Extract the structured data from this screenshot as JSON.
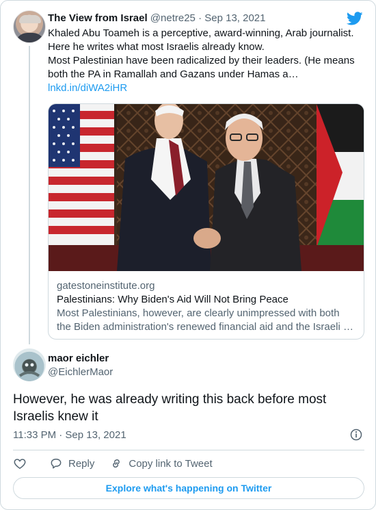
{
  "quoted": {
    "author_name": "The View from Israel",
    "handle": "@netre25",
    "separator": "·",
    "date": "Sep 13, 2021",
    "text_lines": [
      "Khaled Abu Toameh is a perceptive, award-winning, Arab journalist.",
      "Here he writes what most Israelis already know.",
      "Most Palestinian have been radicalized by their leaders. (He means",
      "both the PA in Ramallah and Gazans under Hamas a…"
    ],
    "link": "lnkd.in/diWA2iHR",
    "card": {
      "domain": "gatestoneinstitute.org",
      "title": "Palestinians: Why Biden's Aid Will Not Bring Peace",
      "description_lines": [
        "Most Palestinians, however, are clearly unimpressed with both",
        "the Biden administration's renewed financial aid and the Israeli …"
      ]
    }
  },
  "tweet": {
    "author_name": "maor eichler",
    "handle": "@EichlerMaor",
    "text": "However, he was already writing this back before most Israelis knew it",
    "timestamp": "11:33 PM · Sep 13, 2021"
  },
  "actions": {
    "reply_label": "Reply",
    "copy_label": "Copy link to Tweet"
  },
  "explore_label": "Explore what's happening on Twitter",
  "icons": {
    "brand": "twitter-bird-icon",
    "like": "heart-icon",
    "reply": "speech-bubble-icon",
    "copy": "link-icon",
    "info": "info-icon"
  },
  "colors": {
    "accent": "#1d9bf0",
    "text": "#0f1419",
    "muted": "#536471",
    "border": "#cfd9de"
  }
}
